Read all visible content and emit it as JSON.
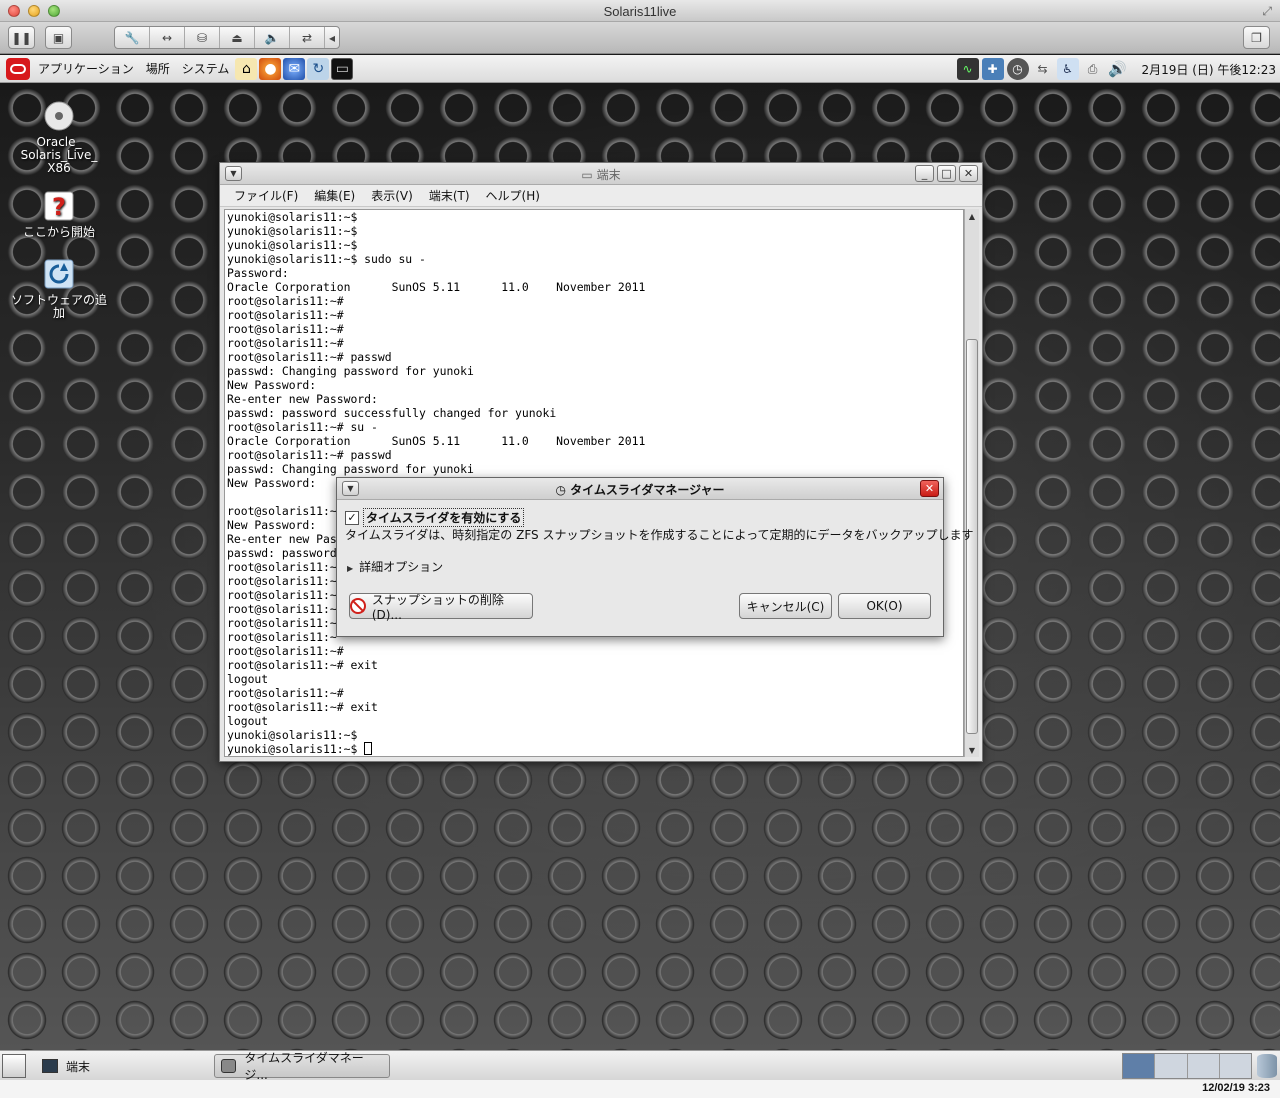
{
  "host": {
    "window_title": "Solaris11live",
    "clock": "12/02/19 3:23"
  },
  "top_panel": {
    "menus": [
      "アプリケーション",
      "場所",
      "システム"
    ],
    "clock": "2月19日 (日) 午後12:23"
  },
  "desktop": {
    "icons": [
      {
        "label": "Oracle_ Solaris_Live_ X86"
      },
      {
        "label": "ここから開始"
      },
      {
        "label": "ソフトウェアの追加"
      }
    ]
  },
  "terminal": {
    "title": "端末",
    "menus": [
      "ファイル(F)",
      "編集(E)",
      "表示(V)",
      "端末(T)",
      "ヘルプ(H)"
    ],
    "lines": [
      "yunoki@solaris11:~$",
      "yunoki@solaris11:~$",
      "yunoki@solaris11:~$",
      "yunoki@solaris11:~$ sudo su -",
      "Password:",
      "Oracle Corporation      SunOS 5.11      11.0    November 2011",
      "root@solaris11:~#",
      "root@solaris11:~#",
      "root@solaris11:~#",
      "root@solaris11:~#",
      "root@solaris11:~# passwd",
      "passwd: Changing password for yunoki",
      "New Password:",
      "Re-enter new Password:",
      "passwd: password successfully changed for yunoki",
      "root@solaris11:~# su -",
      "Oracle Corporation      SunOS 5.11      11.0    November 2011",
      "root@solaris11:~# passwd",
      "passwd: Changing password for yunoki",
      "New Password:",
      "",
      "root@solaris11:~",
      "New Password:",
      "Re-enter new Pas",
      "passwd: password",
      "root@solaris11:~",
      "root@solaris11:~",
      "root@solaris11:~",
      "root@solaris11:~",
      "root@solaris11:~",
      "root@solaris11:~",
      "root@solaris11:~#",
      "root@solaris11:~# exit",
      "logout",
      "root@solaris11:~#",
      "root@solaris11:~# exit",
      "logout",
      "yunoki@solaris11:~$",
      "yunoki@solaris11:~$ "
    ]
  },
  "dialog": {
    "title": "タイムスライダマネージャー",
    "enable_label": "タイムスライダを有効にする",
    "description": "タイムスライダは、時刻指定の ZFS スナップショットを作成することによって定期的にデータをバックアップします",
    "advanced_label": "詳細オプション",
    "delete_button": "スナップショットの削除(D)...",
    "cancel_button": "キャンセル(C)",
    "ok_button": "OK(O)"
  },
  "bottom_panel": {
    "tasks": [
      "端末",
      "タイムスライダマネージ..."
    ]
  }
}
